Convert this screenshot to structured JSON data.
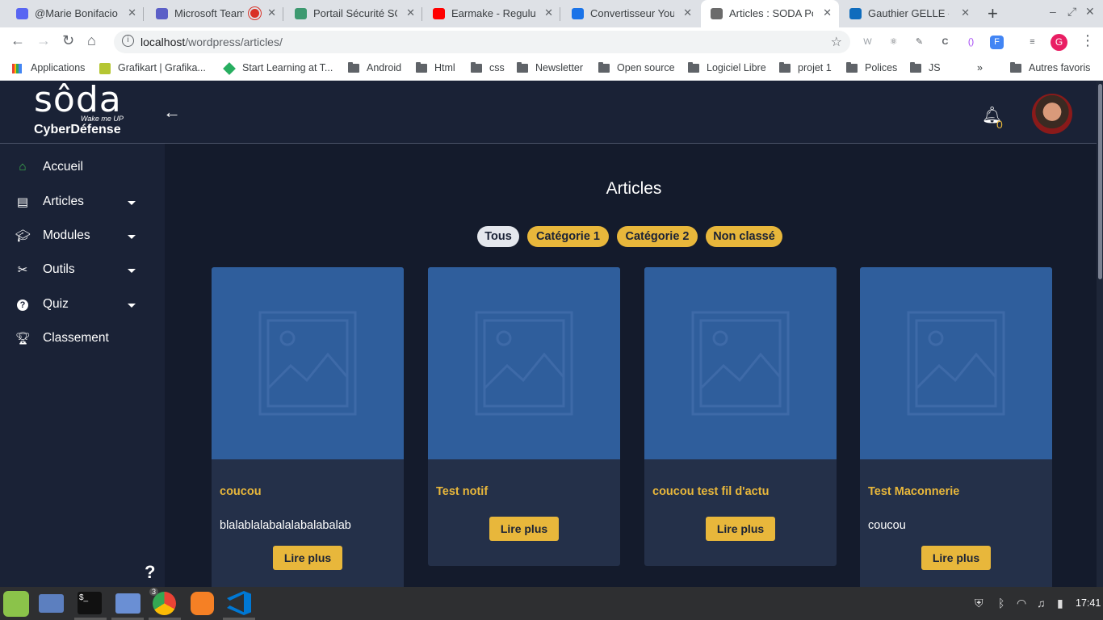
{
  "browser": {
    "tabs": [
      {
        "title": "@Marie Bonifacio -",
        "favicon_color": "#5865f2"
      },
      {
        "title": "Microsoft Team",
        "favicon_color": "#5b5fc7"
      },
      {
        "title": "Portail Sécurité SOC",
        "favicon_color": "#3d9970"
      },
      {
        "title": "Earmake - Regulus",
        "favicon_color": "#ff0000"
      },
      {
        "title": "Convertisseur Yout",
        "favicon_color": "#1a73e8"
      },
      {
        "title": "Articles : SODA Por",
        "favicon_color": "#6b6b6b"
      },
      {
        "title": "Gauthier GELLE - O",
        "favicon_color": "#0f6cbd"
      }
    ],
    "active_tab_index": 5,
    "url_host": "localhost",
    "url_path": "/wordpress/articles/",
    "bookmarks": [
      "Applications",
      "Grafikart | Grafika...",
      "Start Learning at T...",
      "Android",
      "Html",
      "css",
      "Newsletter",
      "Open source",
      "Logiciel Libre",
      "projet 1",
      "Polices",
      "JS"
    ],
    "other_bookmarks": "Autres favoris",
    "profile_initial": "G"
  },
  "header": {
    "logo_name": "sôda",
    "logo_tagline": "Wake me UP",
    "logo_sub": "CyberDéfense",
    "notification_count": "0"
  },
  "sidebar": {
    "items": [
      {
        "label": "Accueil",
        "icon": "home-icon"
      },
      {
        "label": "Articles",
        "icon": "newspaper-icon"
      },
      {
        "label": "Modules",
        "icon": "graduation-cap-icon"
      },
      {
        "label": "Outils",
        "icon": "tools-icon"
      },
      {
        "label": "Quiz",
        "icon": "question-circle-icon"
      },
      {
        "label": "Classement",
        "icon": "trophy-icon"
      }
    ],
    "help": "?"
  },
  "main": {
    "title": "Articles",
    "filters": [
      "Tous",
      "Catégorie 1",
      "Catégorie 2",
      "Non classé"
    ],
    "active_filter_index": 0,
    "articles": [
      {
        "title": "coucou",
        "excerpt": "blalablalabalalabalabalab",
        "button": "Lire plus"
      },
      {
        "title": "Test notif",
        "excerpt": "",
        "button": "Lire plus"
      },
      {
        "title": "coucou test fil d'actu",
        "excerpt": "",
        "button": "Lire plus"
      },
      {
        "title": "Test Maconnerie",
        "excerpt": "coucou",
        "button": "Lire plus"
      }
    ]
  },
  "colors": {
    "accent": "#e8b73b",
    "sidebar_bg": "#1a2236",
    "main_bg": "#141b2c",
    "card_bg": "#243049",
    "card_image_bg": "#2f5e9c",
    "home_icon": "#3fb950"
  },
  "taskbar": {
    "chrome_badge": "3",
    "clock": "17:41"
  }
}
